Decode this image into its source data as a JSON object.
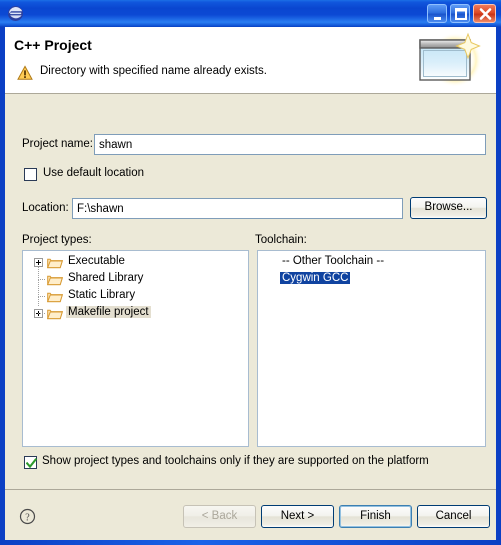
{
  "window": {
    "app_icon": "eclipse-icon",
    "controls": [
      {
        "name": "minimize-button",
        "glyph": "minimize-icon"
      },
      {
        "name": "maximize-button",
        "glyph": "maximize-icon"
      },
      {
        "name": "close-button",
        "glyph": "close-icon"
      }
    ]
  },
  "header": {
    "title": "C++ Project",
    "message": "Directory with specified name already exists.",
    "message_icon": "warning-icon",
    "banner_art": "new-project-wizard-icon"
  },
  "form": {
    "project_name_label": "Project name:",
    "project_name_value": "shawn",
    "use_default_location_label": "Use default location",
    "use_default_location_checked": false,
    "location_label": "Location:",
    "location_value": "F:\\shawn",
    "browse_label": "Browse..."
  },
  "project_types": {
    "label": "Project types:",
    "items": [
      {
        "label": "Executable",
        "expandable": true,
        "selected": false
      },
      {
        "label": "Shared Library",
        "expandable": false,
        "selected": false
      },
      {
        "label": "Static Library",
        "expandable": false,
        "selected": false
      },
      {
        "label": "Makefile project",
        "expandable": true,
        "selected": true
      }
    ]
  },
  "toolchain": {
    "label": "Toolchain:",
    "items": [
      {
        "label": "-- Other Toolchain --",
        "selected": false
      },
      {
        "label": "Cygwin GCC",
        "selected": true
      }
    ]
  },
  "options": {
    "show_supported_label": "Show project types and toolchains only if they are supported on the platform",
    "show_supported_checked": true
  },
  "footer": {
    "help_icon": "help-question-icon",
    "back_label": "< Back",
    "next_label": "Next >",
    "finish_label": "Finish",
    "cancel_label": "Cancel"
  },
  "colors": {
    "titlebar_blue": "#0a46d2",
    "dialog_face": "#ece9d8",
    "selection_blue": "#1043a0",
    "selection_inactive": "#e4dfd0",
    "check_green": "#2d9a2d",
    "field_border": "#7f9db9"
  }
}
